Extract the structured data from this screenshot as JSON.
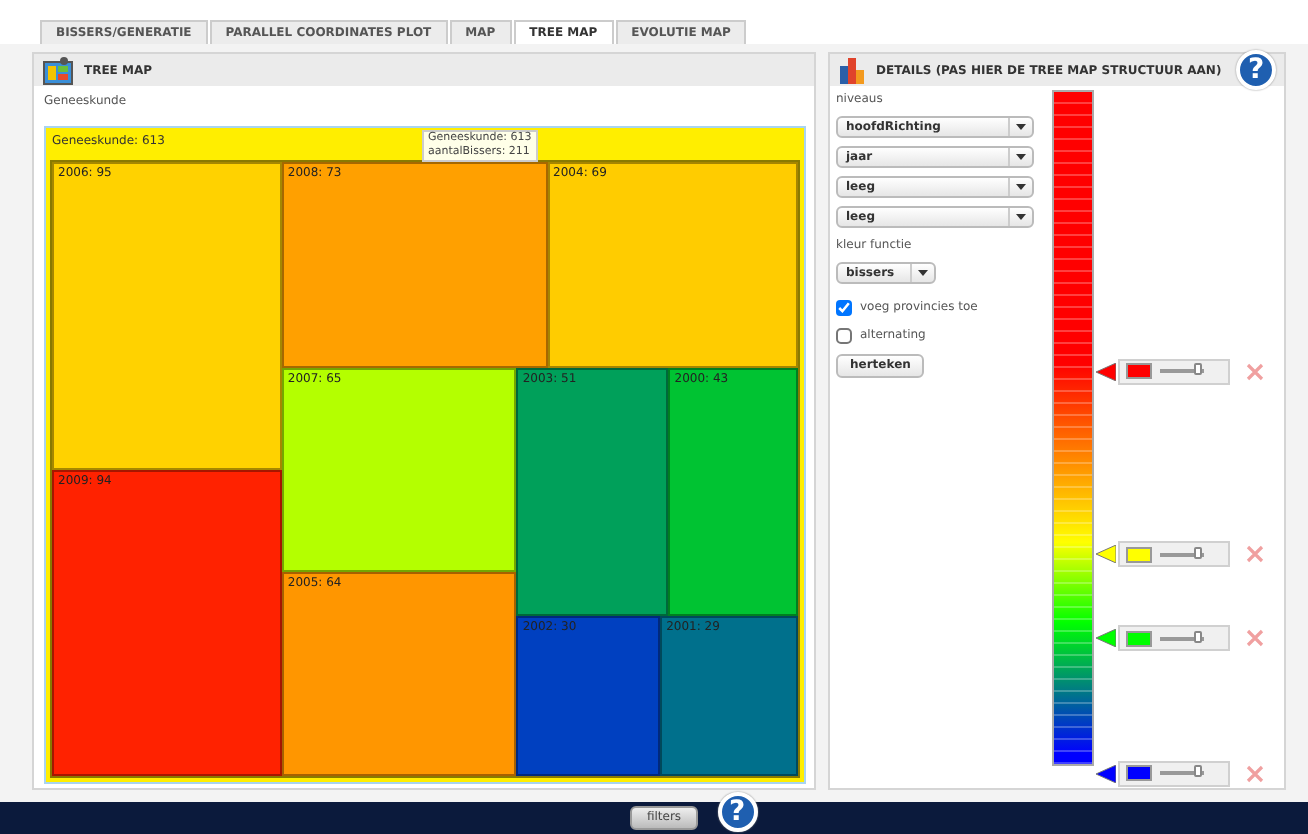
{
  "tabs": [
    {
      "label": "BISSERS/GENERATIE",
      "selected": false
    },
    {
      "label": "PARALLEL COORDINATES PLOT",
      "selected": false
    },
    {
      "label": "MAP",
      "selected": false
    },
    {
      "label": "TREE MAP",
      "selected": true
    },
    {
      "label": "EVOLUTIE MAP",
      "selected": false
    }
  ],
  "treemap_panel": {
    "title": "TREE MAP",
    "breadcrumb": "Geneeskunde",
    "root": {
      "label": "Geneeskunde: 613",
      "color": "#ffee00"
    },
    "cells": [
      {
        "label": "2006: 95",
        "color": "#ffd200"
      },
      {
        "label": "2009: 94",
        "color": "#ff2200"
      },
      {
        "label": "2008: 73",
        "color": "#ffa000"
      },
      {
        "label": "2004: 69",
        "color": "#ffcc00"
      },
      {
        "label": "2007: 65",
        "color": "#b4ff00"
      },
      {
        "label": "2005: 64",
        "color": "#ff9600"
      },
      {
        "label": "2003: 51",
        "color": "#00a05a"
      },
      {
        "label": "2000: 43",
        "color": "#00c332"
      },
      {
        "label": "2002: 30",
        "color": "#0040c0"
      },
      {
        "label": "2001: 29",
        "color": "#00708c"
      }
    ],
    "tooltip": [
      "Geneeskunde: 613",
      "aantalBissers: 211"
    ]
  },
  "details_panel": {
    "title": "DETAILS (PAS HIER DE TREE MAP STRUCTUUR AAN)",
    "help": "?",
    "levels_label": "niveaus",
    "levels": [
      "hoofdRichting",
      "jaar",
      "leeg",
      "leeg"
    ],
    "color_function_label": "kleur functie",
    "color_function": "bissers",
    "checkboxes": [
      {
        "label": "voeg provincies toe",
        "checked": true
      },
      {
        "label": "alternating",
        "checked": false
      }
    ],
    "redraw_button": "herteken",
    "color_stops": [
      {
        "color": "#ff0000",
        "level": 0.85
      },
      {
        "color": "#ffff00",
        "level": 0.85
      },
      {
        "color": "#00ff00",
        "level": 0.85
      },
      {
        "color": "#0000ff",
        "level": 0.85
      }
    ]
  },
  "footer": {
    "button": "filters",
    "help": "?"
  }
}
